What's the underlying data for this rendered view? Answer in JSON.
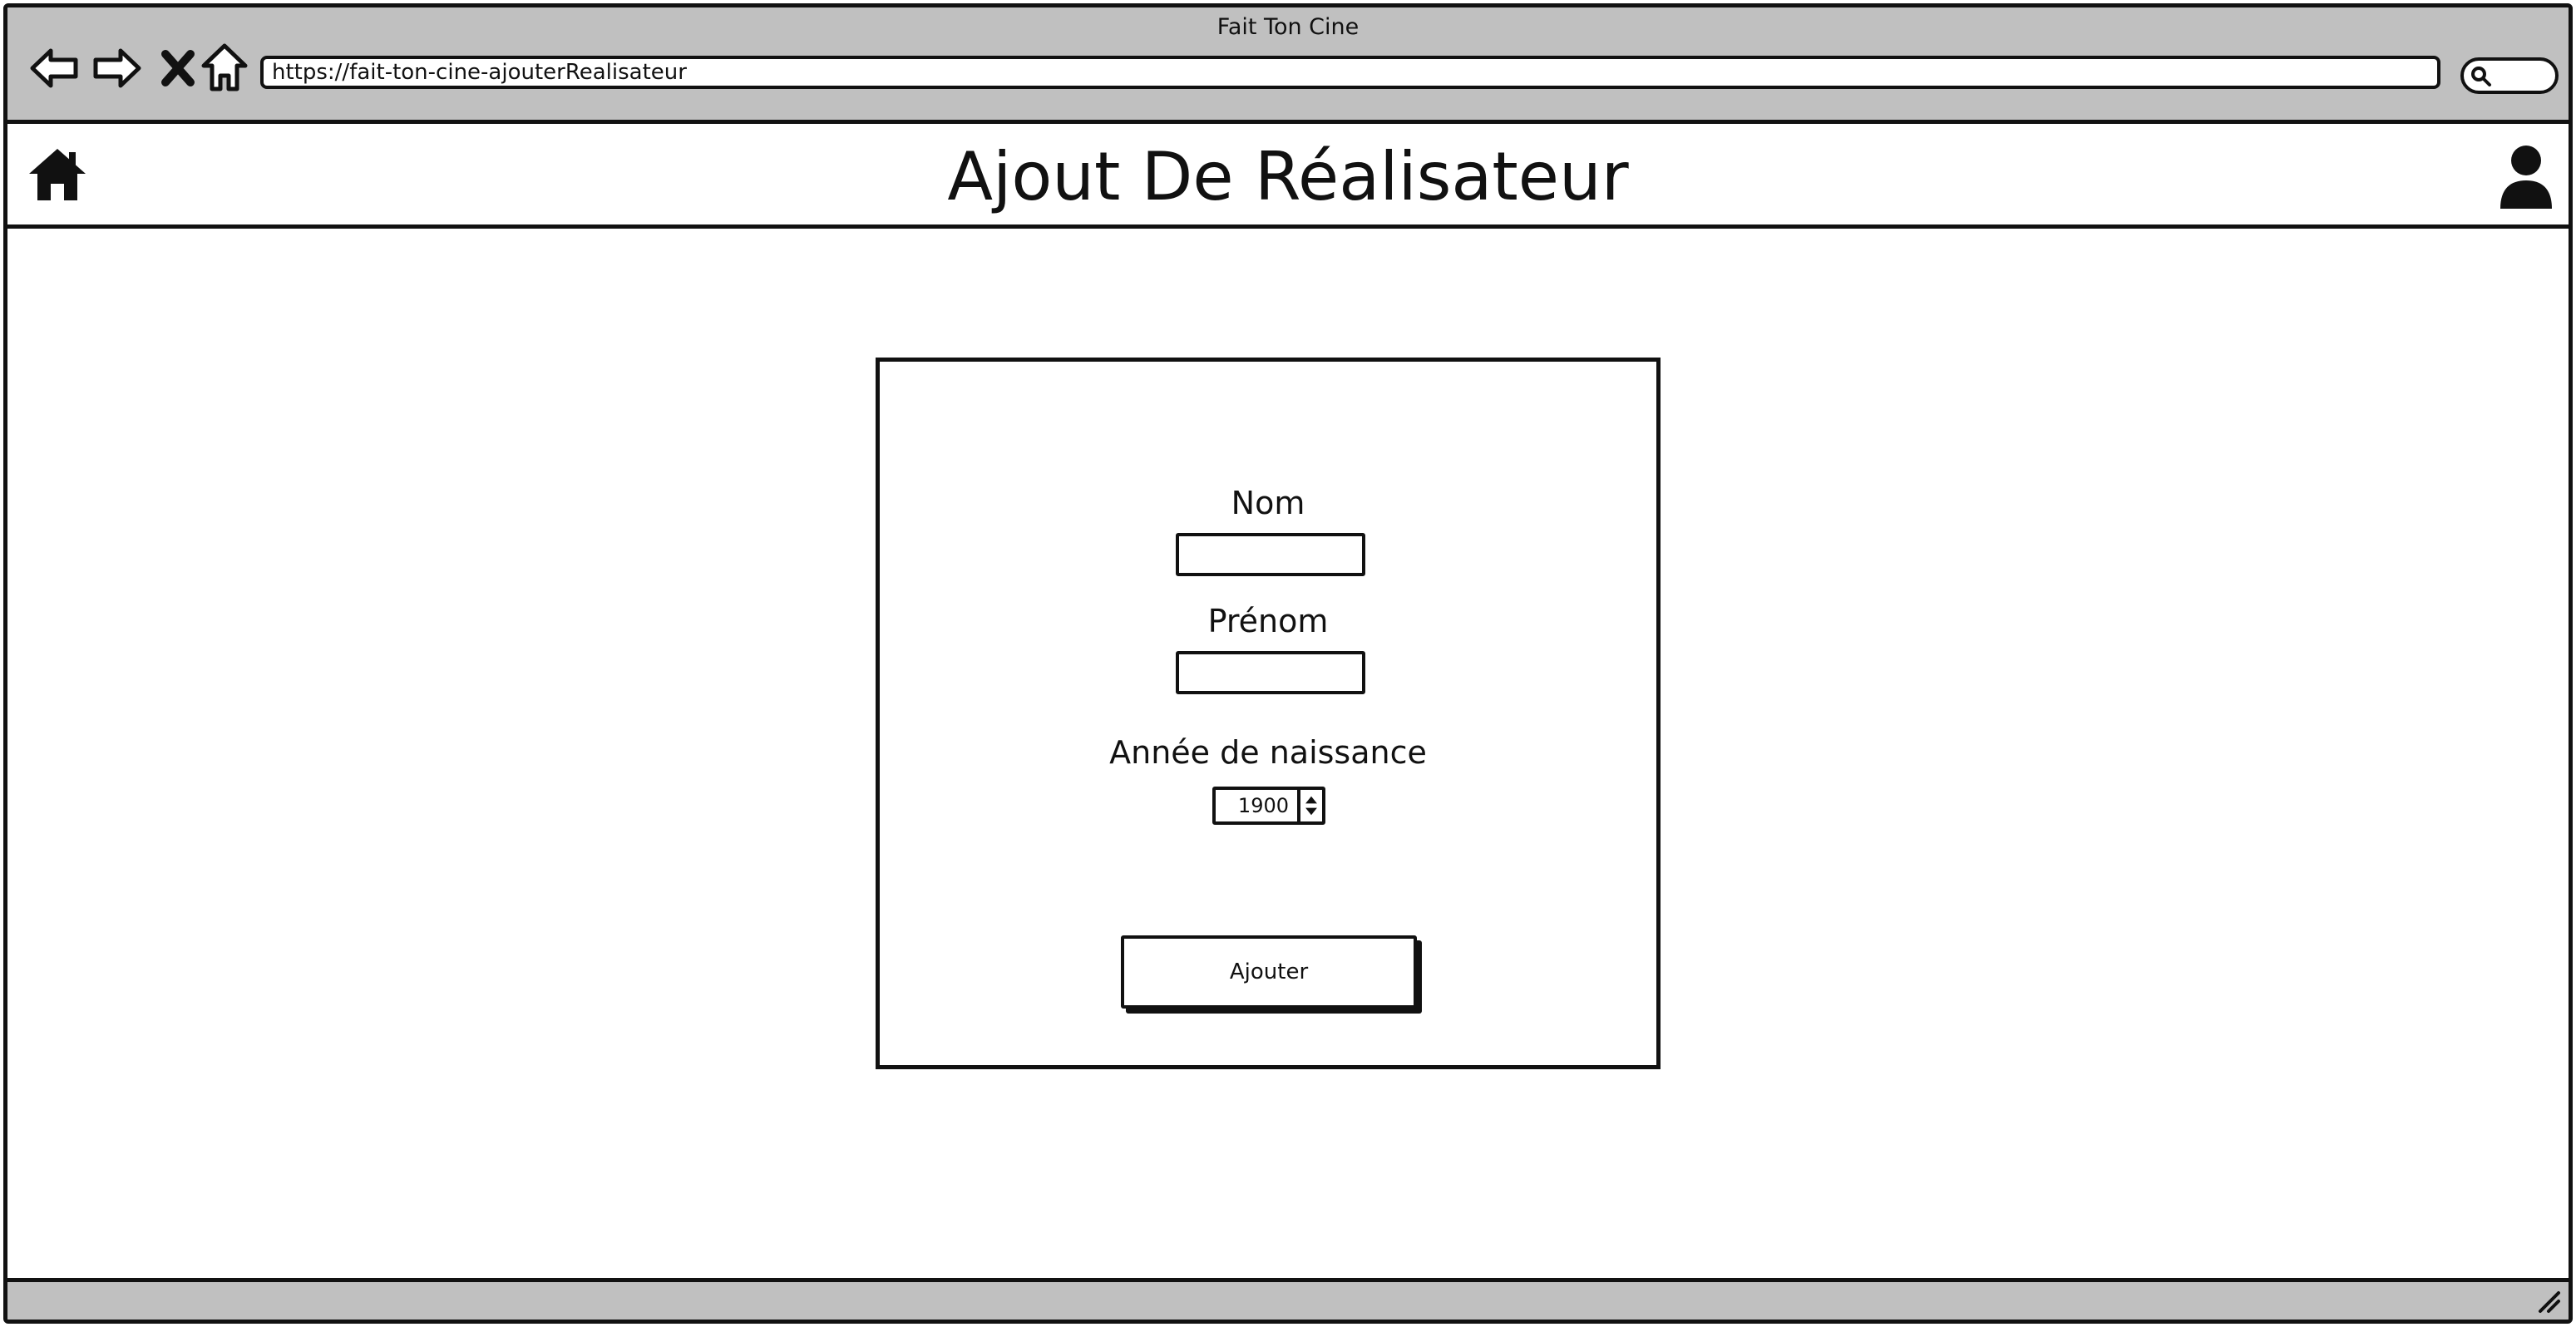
{
  "window": {
    "title": "Fait Ton Cine"
  },
  "browser": {
    "url": "https://fait-ton-cine-ajouterRealisateur",
    "icons": {
      "back": "back-arrow-icon",
      "forward": "forward-arrow-icon",
      "stop": "close-icon",
      "home": "home-outline-icon",
      "search": "search-icon"
    }
  },
  "appbar": {
    "title": "Ajout De Réalisateur",
    "home_icon": "home-icon",
    "user_icon": "user-icon"
  },
  "form": {
    "nom": {
      "label": "Nom",
      "value": ""
    },
    "prenom": {
      "label": "Prénom",
      "value": ""
    },
    "annee": {
      "label": "Année de naissance",
      "value": "1900"
    },
    "submit_label": "Ajouter"
  }
}
